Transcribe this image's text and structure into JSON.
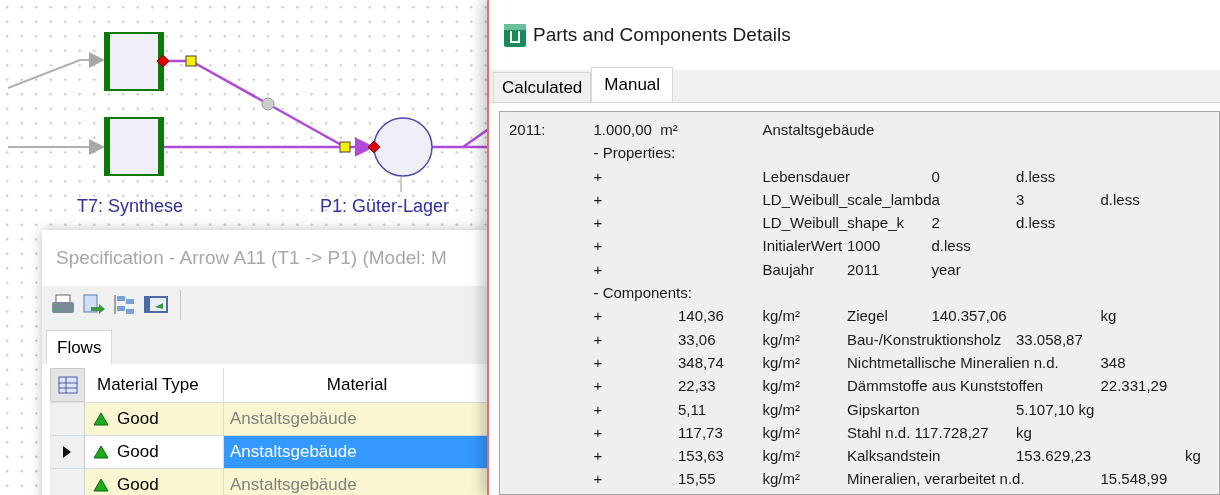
{
  "diagram": {
    "nodes": [
      {
        "kind": "transition",
        "label": "T7: Synthese"
      },
      {
        "kind": "transition"
      },
      {
        "kind": "place",
        "label": "P1: Güter-Lager"
      }
    ]
  },
  "specification": {
    "title": "Specification - Arrow A11 (T1 -> P1) (Model: M",
    "tabs": [
      {
        "label": "Flows",
        "selected": true
      }
    ],
    "columns": [
      "Material Type",
      "Material"
    ],
    "rows": [
      {
        "type": "Good",
        "material": "Anstaltsgebäude",
        "selected": false
      },
      {
        "type": "Good",
        "material": "Anstaltsgebäude",
        "selected": true
      },
      {
        "type": "Good",
        "material": "Anstaltsgebäude",
        "selected": false
      }
    ]
  },
  "details": {
    "title": "Parts and Components Details",
    "tabs": [
      {
        "label": "Calculated",
        "selected": false
      },
      {
        "label": "Manual",
        "selected": true
      }
    ],
    "lines": [
      "2011:\t1.000,00  m²\tAnstaltsgebäude",
      "\t- Properties:",
      "\t+\t\tLebensdauer\t0\td.less",
      "\t+\t\tLD_Weibull_scale_lambda\t3\td.less",
      "\t+\t\tLD_Weibull_shape_k\t2\td.less",
      "\t+\t\tInitialerWert\t1000\td.less",
      "\t+\t\tBaujahr\t2011\tyear",
      "\t- Components:",
      "\t+\t140,36\tkg/m²\tZiegel\t140.357,06\t\tkg",
      "\t+\t33,06\tkg/m²\tBau-/Konstruktionsholz\t33.058,87",
      "\t+\t348,74\tkg/m²\tNichtmetallische Mineralien n.d.\t348",
      "\t+\t22,33\tkg/m²\tDämmstoffe aus Kunststoffen\t22.331,29",
      "\t+\t5,11\tkg/m²\tGipskarton\t\t5.107,10 kg",
      "\t+\t117,73\tkg/m²\tStahl n.d. 117.728,27\tkg",
      "\t+\t153,63\tkg/m²\tKalksandstein\t153.629,23\t\tkg",
      "\t+\t15,55\tkg/m²\tMineralien, verarbeitet n.d.\t15.548,99"
    ]
  }
}
